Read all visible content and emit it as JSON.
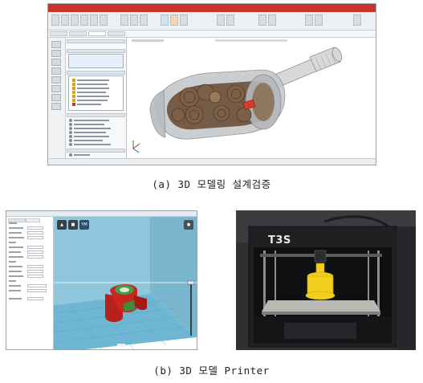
{
  "captions": {
    "a": "(a) 3D 모델링 설계검증",
    "b": "(b) 3D 모델 Printer"
  },
  "printer_photo": {
    "brand_label": "T3S"
  },
  "slicer": {
    "toolbar_badge": "YM"
  },
  "colors": {
    "cad_menubar": "#c8342c",
    "part_tan": "#7b6045",
    "highlight_red": "#d93a2f",
    "build_volume": "#8fc6dc",
    "print_red": "#b8201c",
    "print_green": "#4a9b45",
    "printed_part_yellow": "#f2cf1d"
  }
}
